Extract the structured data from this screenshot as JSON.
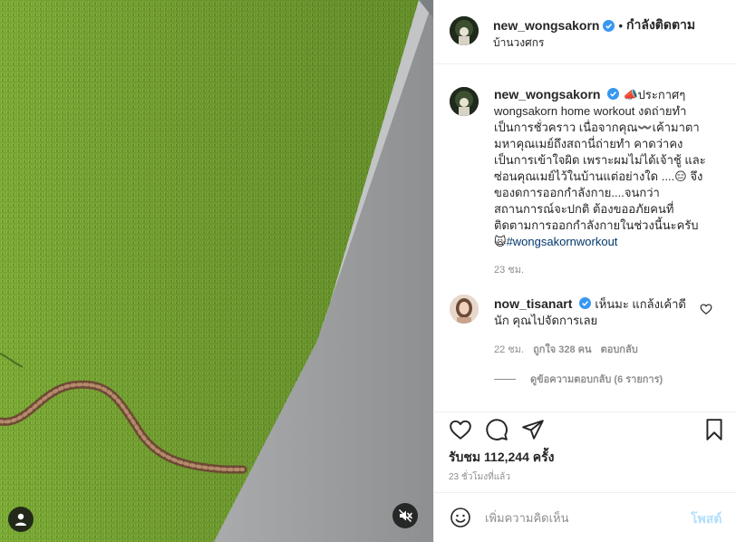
{
  "post": {
    "author": "new_wongsakorn",
    "follow_state": "กำลังติดตาม",
    "location": "บ้านวงศกร",
    "caption": "📣ประกาศๆ wongsakorn home workout งดถ่ายทำเป็นการชั่วคราว เนื่อจากคุณ〰️เค้ามาตามหาคุณเมย์ถึงสถานี่ถ่ายทำ คาดว่าคงเป็นการเข้าใจผิด เพราะผมไม่ได้เจ้าชู้ และซ่อนคุณเมย์ไว้ในบ้านแต่อย่างใด ....😑 จึงของดการออกกำลังกาย....จนกว่าสถานการณ์จะปกติ ต้องขออภัยคนที่ติดตามการออกกำลังกายในช่วงนี้นะครับ🙀",
    "hashtag": "#wongsakornworkout",
    "caption_time": "23 ชม."
  },
  "comment": {
    "author": "now_tisanart",
    "text": "เห็นมะ แกล้งเค้าดีนัก คุณไปจัดการเลย",
    "time": "22 ชม.",
    "likes": "ถูกใจ 328 คน",
    "reply_label": "ตอบกลับ",
    "view_replies": "ดูข้อความตอบกลับ (6 รายการ)"
  },
  "stats": {
    "views": "รับชม 112,244 ครั้ง",
    "posted_ago": "23 ชั่วโมงที่แล้ว"
  },
  "add_comment": {
    "placeholder": "เพิ่มความคิดเห็น",
    "post_label": "โพสต์"
  },
  "colors": {
    "verified": "#3897f0",
    "link": "#00376b",
    "muted": "#8e8e8e",
    "post_disabled": "#b2dffc"
  },
  "icons": {
    "tag": "user-tag-icon",
    "mute": "muted-speaker-icon",
    "like": "heart-icon",
    "comment": "comment-bubble-icon",
    "share": "paper-plane-icon",
    "save": "bookmark-icon",
    "emoji": "smiley-icon"
  }
}
